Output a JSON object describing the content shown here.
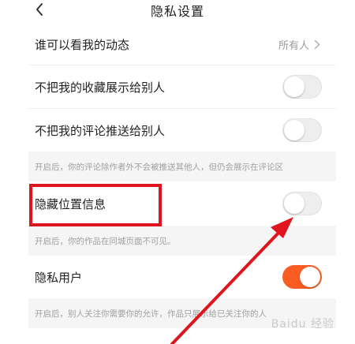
{
  "header": {
    "title": "隐私设置"
  },
  "icons": {
    "back": "chevron-left-icon",
    "chevron": "chevron-right-icon"
  },
  "colors": {
    "accent": "#fb5c22",
    "highlight": "#e0141e"
  },
  "settings": {
    "who_can_see": {
      "label": "谁可以看我的动态",
      "value": "所有人"
    },
    "hide_favorites": {
      "label": "不把我的收藏展示给别人",
      "enabled": false
    },
    "hide_comments": {
      "label": "不把我的评论推送给别人",
      "enabled": false
    },
    "comments_note": "开启后，你的评论除作者外不会被推送其他人，但仍会展示在评论区",
    "hide_location": {
      "label": "隐藏位置信息",
      "enabled": false
    },
    "location_note": "开启后，你的作品在同城页面不可见。",
    "private_user": {
      "label": "隐私用户",
      "enabled": true
    },
    "private_note": "开启后，别人关注你需要你的允许，作品只展示给已关注你的人"
  },
  "watermark": "Baidu 经验"
}
